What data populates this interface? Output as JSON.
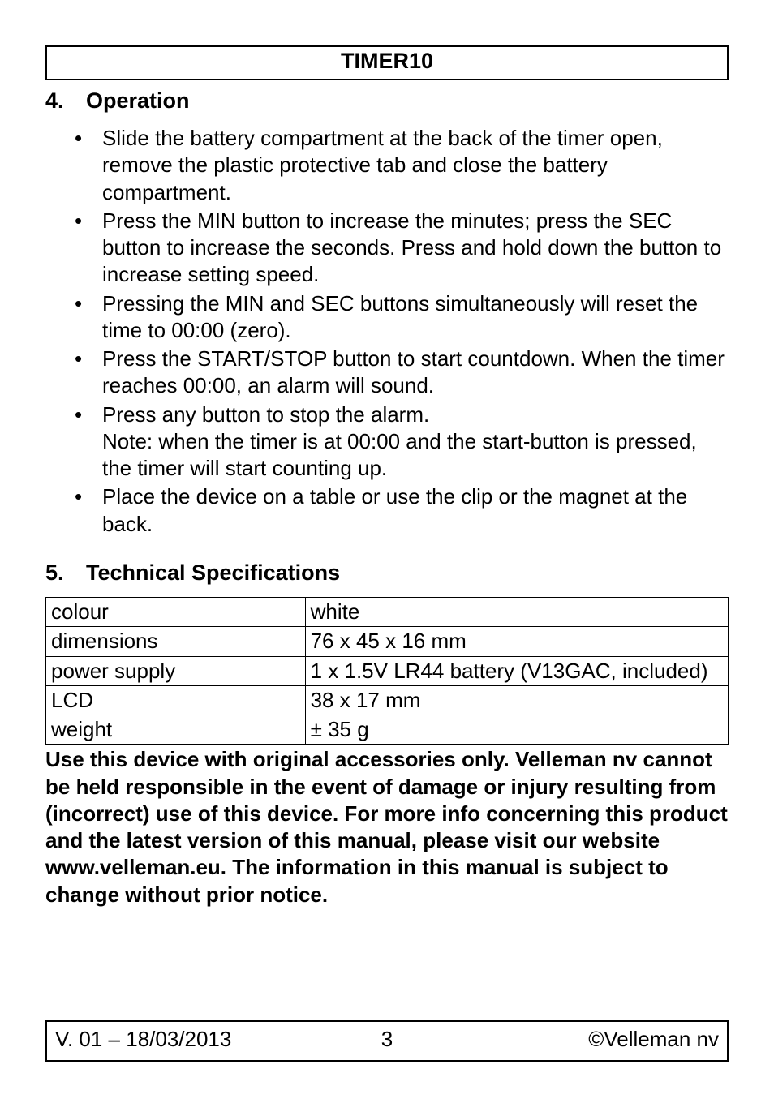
{
  "header": {
    "title": "TIMER10"
  },
  "section4": {
    "number": "4.",
    "title": "Operation",
    "items": [
      "Slide the battery compartment at the back of the timer open, remove the plastic protective tab and close the battery compartment.",
      "Press the MIN button to increase the minutes; press the SEC button to increase the seconds. Press and hold down the button to increase setting speed.",
      "Pressing the MIN and SEC buttons simultaneously will reset the time to 00:00 (zero).",
      "Press the START/STOP button to start countdown. When the timer reaches 00:00, an alarm will sound.",
      "Press any button to stop the alarm.\nNote: when the timer is at 00:00 and the start-button is pressed, the timer will start counting up.",
      "Place the device on a table or use the clip or the magnet at the back."
    ]
  },
  "section5": {
    "number": "5.",
    "title": "Technical Specifications",
    "rows": [
      {
        "label": "colour",
        "value": "white"
      },
      {
        "label": "dimensions",
        "value": "76 x 45 x 16 mm"
      },
      {
        "label": "power supply",
        "value": "1 x 1.5V LR44 battery (V13GAC, included)"
      },
      {
        "label": "LCD",
        "value": "38 x 17 mm"
      },
      {
        "label": "weight",
        "value": "± 35 g"
      }
    ]
  },
  "disclaimer": "Use this device with original accessories only. Velleman nv cannot be held responsible in the event of damage or injury resulting from (incorrect) use of this device. For more info concerning this product and the latest version of this manual, please visit our website www.velleman.eu. The information in this manual is subject to change without prior notice.",
  "footer": {
    "version": "V. 01 – 18/03/2013",
    "page": "3",
    "copyright": "©Velleman nv"
  }
}
